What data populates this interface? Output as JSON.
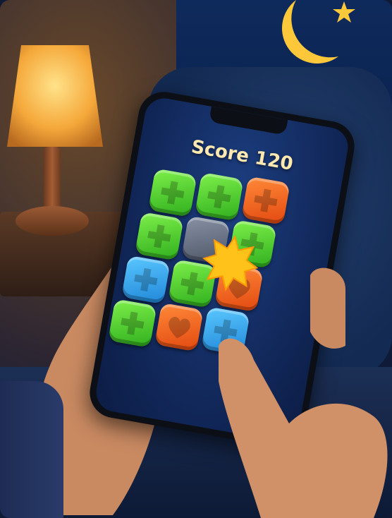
{
  "game": {
    "score_text": "Score 120"
  },
  "board": {
    "tiles": [
      {
        "color": "green",
        "icon": "plus-icon"
      },
      {
        "color": "green",
        "icon": "plus-icon"
      },
      {
        "color": "orange",
        "icon": "plus-icon"
      },
      {
        "color": "green",
        "icon": "plus-icon"
      },
      {
        "color": "gray",
        "icon": "none"
      },
      {
        "color": "green",
        "icon": "plus-icon"
      },
      {
        "color": "blue",
        "icon": "plus-icon"
      },
      {
        "color": "green",
        "icon": "plus-icon"
      },
      {
        "color": "orange",
        "icon": "heart-icon"
      },
      {
        "color": "green",
        "icon": "plus-icon"
      },
      {
        "color": "orange",
        "icon": "heart-icon"
      },
      {
        "color": "blue",
        "icon": "plus-icon"
      }
    ],
    "highlight": "burst-icon"
  },
  "colors": {
    "green": "#4fd12e",
    "orange": "#f2611c",
    "blue": "#35a6ee",
    "burst": "#ffc21a",
    "screen": "#163370"
  }
}
